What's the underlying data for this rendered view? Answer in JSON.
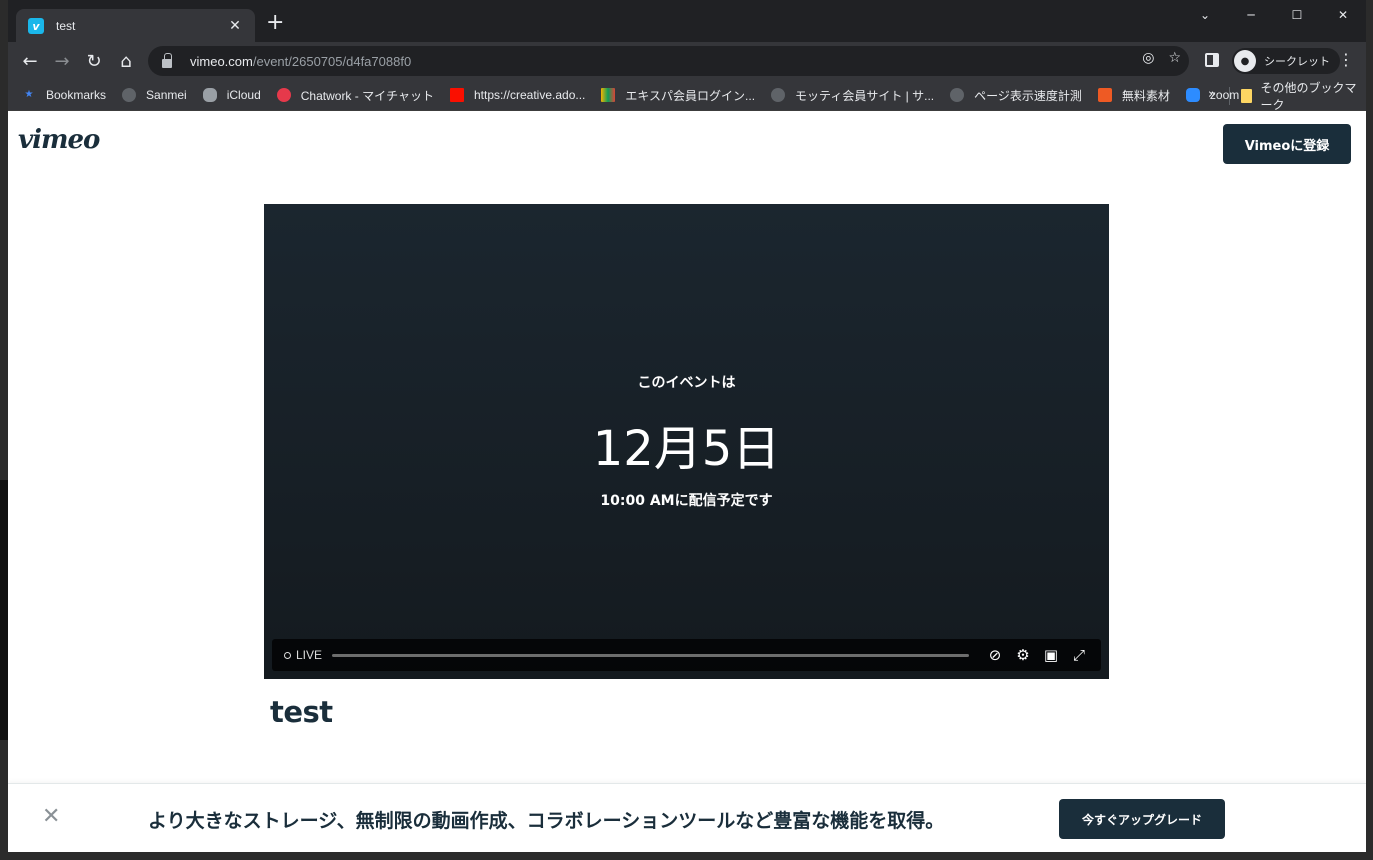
{
  "browser": {
    "tab_title": "test",
    "tab_favicon": "v",
    "new_tab": "+",
    "url_host": "vimeo.com",
    "url_path": "/event/2650705/d4fa7088f0",
    "incognito_label": "シークレット"
  },
  "bookmarks": [
    {
      "label": "Bookmarks",
      "icon": "star-icon",
      "color": "#4285f4"
    },
    {
      "label": "Sanmei",
      "icon": "globe-icon",
      "color": "#9aa0a6"
    },
    {
      "label": "iCloud",
      "icon": "apple-icon",
      "color": "#bdc1c6"
    },
    {
      "label": "Chatwork - マイチャット",
      "icon": "chatwork-icon",
      "color": "#e6394b"
    },
    {
      "label": "https://creative.ado...",
      "icon": "adobe-icon",
      "color": "#ff0000"
    },
    {
      "label": "エキスパ会員ログイン...",
      "icon": "expa-icon",
      "color": "#f4b400"
    },
    {
      "label": "モッティ会員サイト | サ...",
      "icon": "globe-icon",
      "color": "#9aa0a6"
    },
    {
      "label": "ページ表示速度計測",
      "icon": "globe-icon",
      "color": "#9aa0a6"
    },
    {
      "label": "無料素材",
      "icon": "material-icon",
      "color": "#ee5a24"
    },
    {
      "label": "zoom",
      "icon": "zoom-icon",
      "color": "#2d8cff"
    }
  ],
  "bookmarks_more": "»",
  "other_bookmarks": "その他のブックマーク",
  "page": {
    "logo": "vimeo",
    "signup_label": "Vimeoに登録",
    "event_pre": "このイベントは",
    "event_date": "12月5日",
    "event_time": "10:00 AMに配信予定です",
    "live_label": "LIVE",
    "video_title": "test"
  },
  "banner": {
    "text": "より大きなストレージ、無制限の動画作成、コラボレーションツールなど豊富な機能を取得。",
    "upgrade_label": "今すぐアップグレード"
  }
}
